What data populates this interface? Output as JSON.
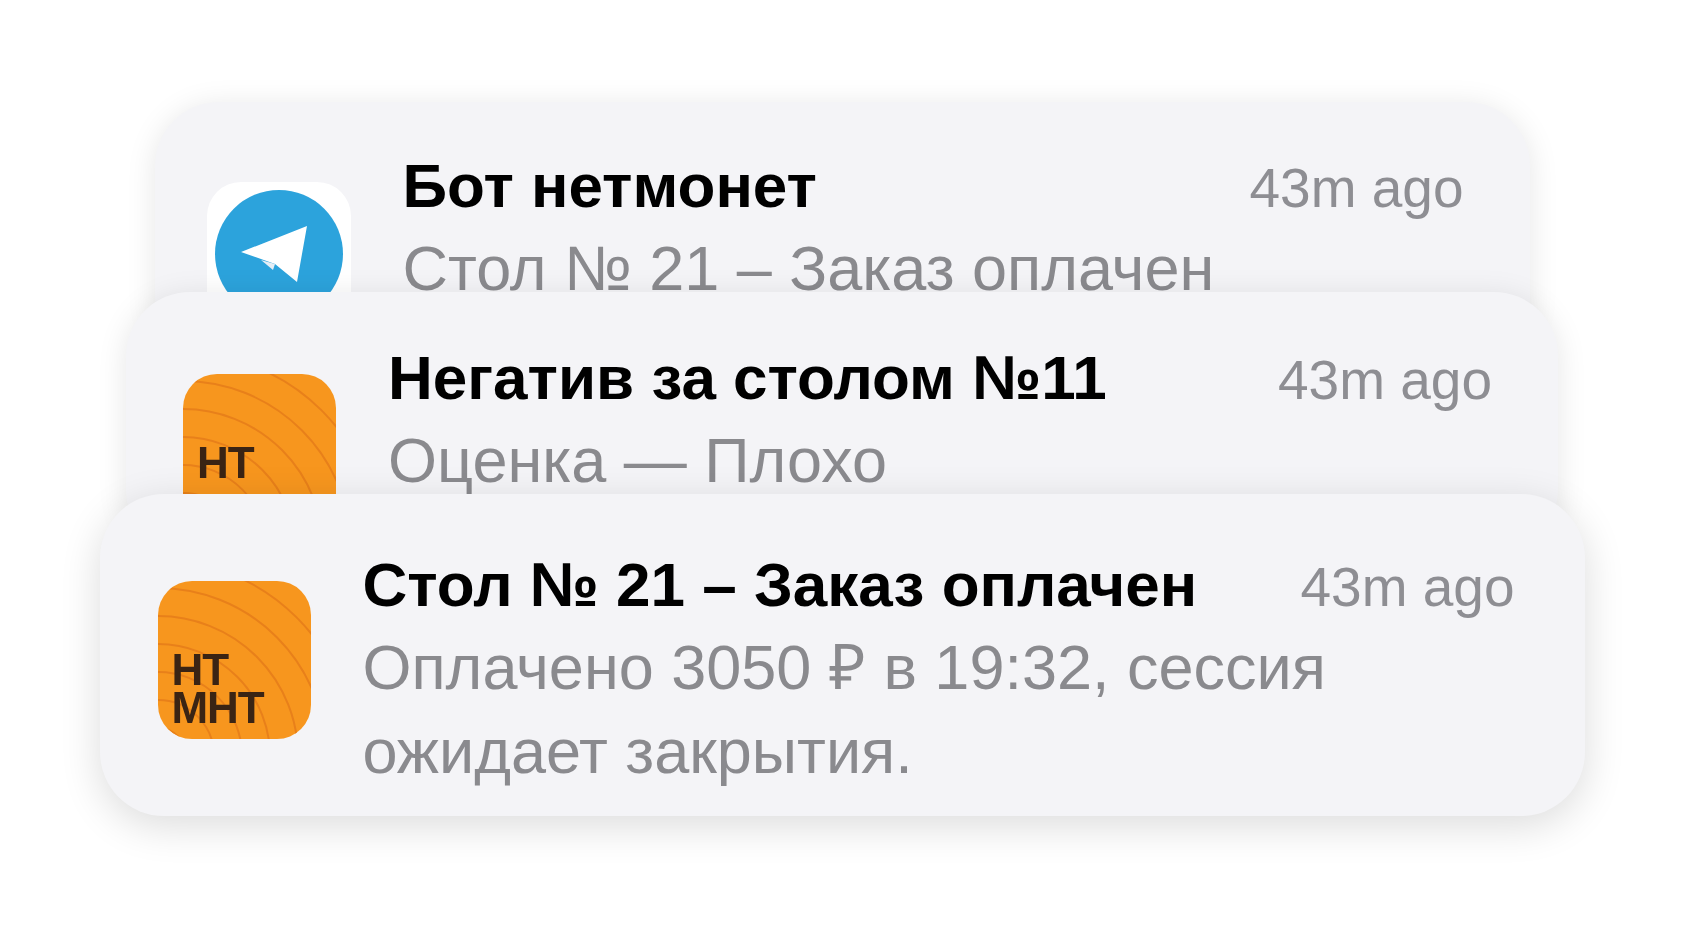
{
  "notifications": [
    {
      "kind": "telegram",
      "title": "Бот нетмонет",
      "time": "43m ago",
      "body": "Стол № 21 – Заказ оплачен"
    },
    {
      "kind": "logo",
      "logo_lines": [
        "НТ"
      ],
      "title": "Негатив за столом №11",
      "time": "43m ago",
      "body": "Оценка — Плохо"
    },
    {
      "kind": "logo",
      "logo_lines": [
        "НТ",
        "МНТ"
      ],
      "title": "Стол № 21 – Заказ оплачен",
      "time": "43m ago",
      "body": "Оплачено 3050 ₽ в 19:32, сессия ожидает закрытия."
    }
  ]
}
